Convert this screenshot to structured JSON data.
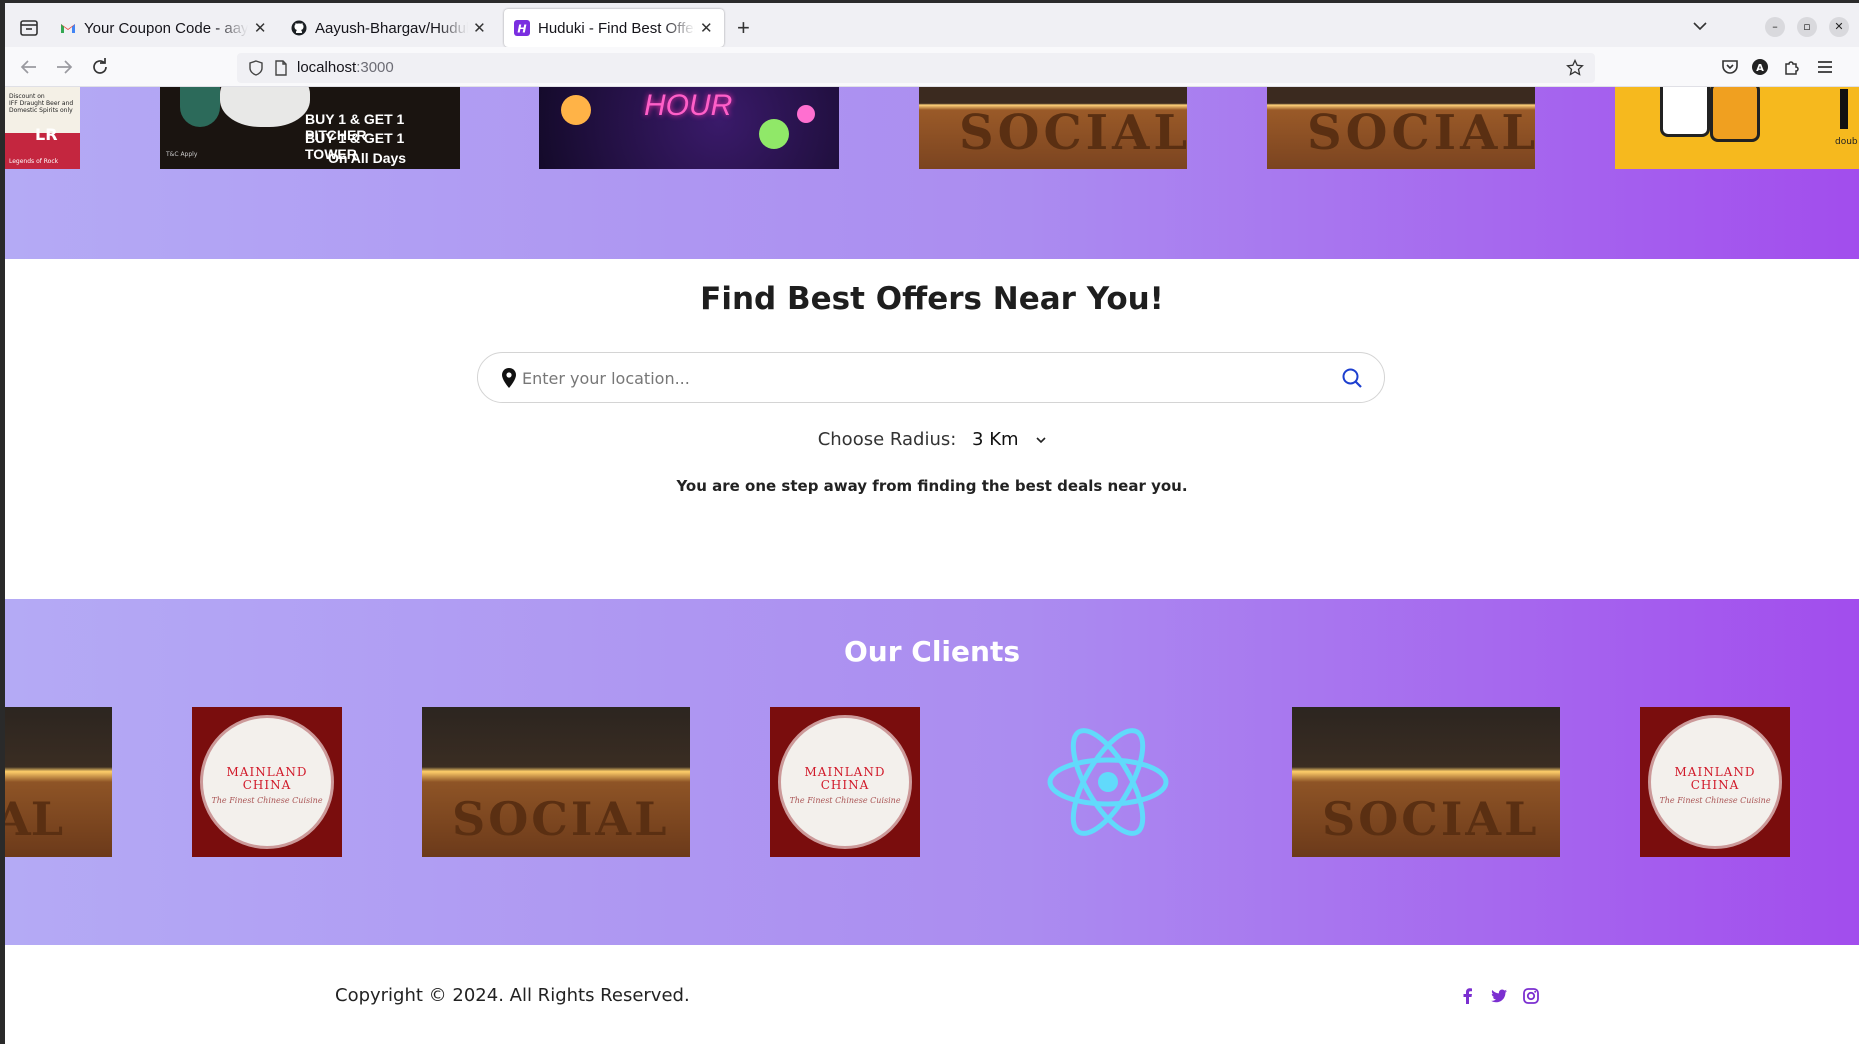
{
  "browser": {
    "tabs": [
      {
        "title": "Your Coupon Code - aayus",
        "favicon": "gmail-icon"
      },
      {
        "title": "Aayush-Bhargav/Huduki-F",
        "favicon": "github-icon"
      },
      {
        "title": "Huduki - Find Best Offers",
        "favicon": "huduki-icon",
        "active": true
      }
    ],
    "url_host": "localhost",
    "url_port": ":3000"
  },
  "banners": [
    {
      "name": "legends-banner",
      "text": "Legends of Rock"
    },
    {
      "name": "pitcher-banner",
      "lines": [
        "BUY 1 & GET 1 PITCHER",
        "BUY 1 & GET 1 TOWER",
        "On All Days"
      ],
      "small": "T&C Apply"
    },
    {
      "name": "happy-hour-banner",
      "text": "HOUR"
    },
    {
      "name": "social-banner-1",
      "text": "SOCIAL"
    },
    {
      "name": "social-banner-2",
      "text": "SOCIAL"
    },
    {
      "name": "beer-banner",
      "text": "doub"
    }
  ],
  "search": {
    "heading": "Find Best Offers Near You!",
    "placeholder": "Enter your location...",
    "radius_label": "Choose Radius:",
    "radius_value": "3 Km",
    "hint": "You are one step away from finding the best deals near you."
  },
  "clients": {
    "title": "Our Clients",
    "logos": [
      {
        "name": "social-logo",
        "text": "AL"
      },
      {
        "name": "mainland-china-logo",
        "brand": "MAINLAND CHINA",
        "tagline": "The Finest Chinese Cuisine"
      },
      {
        "name": "social-logo",
        "text": "SOCIAL"
      },
      {
        "name": "mainland-china-logo",
        "brand": "MAINLAND CHINA",
        "tagline": "The Finest Chinese Cuisine"
      },
      {
        "name": "react-logo"
      },
      {
        "name": "social-logo",
        "text": "SOCIAL"
      },
      {
        "name": "mainland-china-logo",
        "brand": "MAINLAND CHINA",
        "tagline": "The Finest Chinese Cuisine"
      }
    ]
  },
  "footer": {
    "copyright": "Copyright © 2024. All Rights Reserved.",
    "social": [
      "facebook-icon",
      "twitter-icon",
      "instagram-icon"
    ]
  },
  "colors": {
    "gradient_start": "#b4aaf5",
    "gradient_end": "#a24ded",
    "social_icon": "#7b2fd0",
    "search_icon": "#1d3fcf"
  }
}
